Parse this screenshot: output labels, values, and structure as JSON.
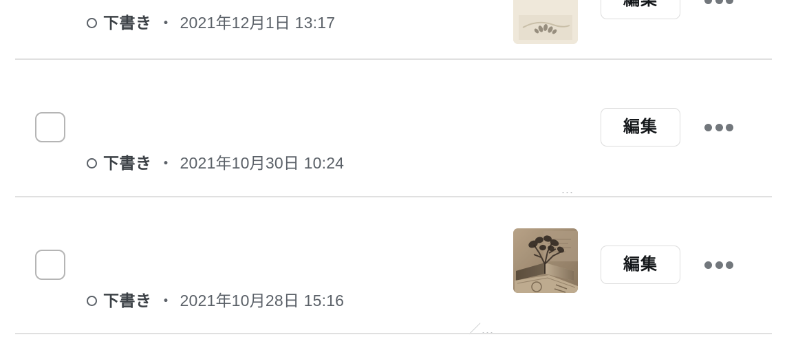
{
  "list": {
    "status_icon": "circle-outline-icon",
    "separator": "・",
    "edit_label": "編集",
    "more_icon": "ellipsis-horizontal-icon",
    "checkbox_icon": "checkbox-unchecked-icon",
    "thumbnail_icon": "post-thumbnail-image",
    "colors": {
      "divider": "#e0e0e0",
      "status_text": "#3c4146",
      "date_text": "#5b6168",
      "checkbox_border": "#b5b5b5",
      "button_border": "#dcdcdc",
      "button_text": "#14171a",
      "more_dots": "#72777c",
      "excerpt_text": "#74797e"
    },
    "rows": [
      {
        "id": "row-partial-top",
        "status": "下書き",
        "date": "2021年12月1日 13:17",
        "excerpt": "",
        "has_thumbnail": true,
        "thumbnail_alt": "ベージュの紙のサムネイル",
        "partial": true
      },
      {
        "id": "row-2021-10-30",
        "status": "下書き",
        "date": "2021年10月30日 10:24",
        "excerpt": "...",
        "has_thumbnail": false,
        "thumbnail_alt": "",
        "partial": false
      },
      {
        "id": "row-2021-10-28",
        "status": "下書き",
        "date": "2021年10月28日 15:16",
        "excerpt": "／...",
        "has_thumbnail": true,
        "thumbnail_alt": "セピア色の開いた本とドライフラワーの写真",
        "partial": false
      }
    ]
  }
}
